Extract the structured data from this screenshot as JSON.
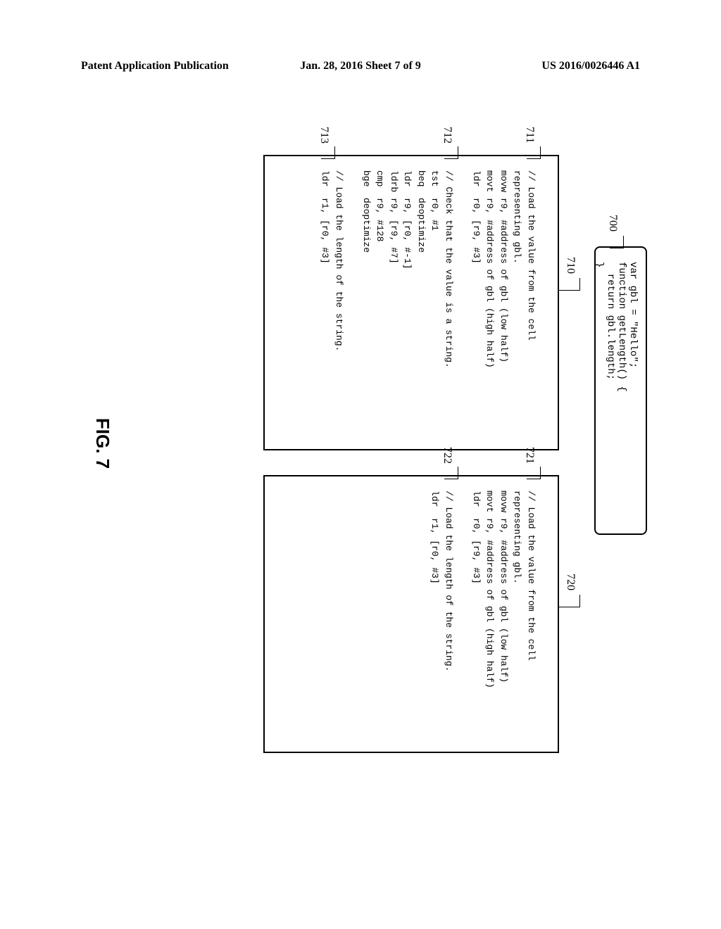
{
  "header": {
    "left": "Patent Application Publication",
    "center": "Jan. 28, 2016  Sheet 7 of 9",
    "right": "US 2016/0026446 A1"
  },
  "source": {
    "line1": "var gbl = \"Hello\";",
    "line2": "function getLength() {",
    "line3": "  return gbl.length;",
    "line4": "}"
  },
  "refs": {
    "r700": "700",
    "r710": "710",
    "r711": "711",
    "r712": "712",
    "r713": "713",
    "r720": "720",
    "r721": "721",
    "r722": "722"
  },
  "box710": {
    "seg1": "// Load the value from the cell\nrepresenting gbl.\nmovw r9, #address of gbl (low half)\nmovt r9, #address of gbl (high half)\nldr  r0, [r9, #3]",
    "seg2": "\n// Check that the value is a string.\ntst  r0, #1\nbeq  deoptimize\nldr  r9, [r0, #-1]\nldrb r9, [r9, #7]\ncmp  r9, #128\nbge  deoptimize",
    "seg3": "\n// Load the length of the string.\nldr  r1, [r0, #3]"
  },
  "box720": {
    "seg1": "// Load the value from the cell\nrepresenting gbl.\nmovw r9, #address of gbl (low half)\nmovt r9, #address of gbl (high half)\nldr  r0, [r9, #3]",
    "seg2": "\n// Load the length of the string.\nldr  r1, [r0, #3]"
  },
  "figure": {
    "label": "FIG. 7"
  }
}
